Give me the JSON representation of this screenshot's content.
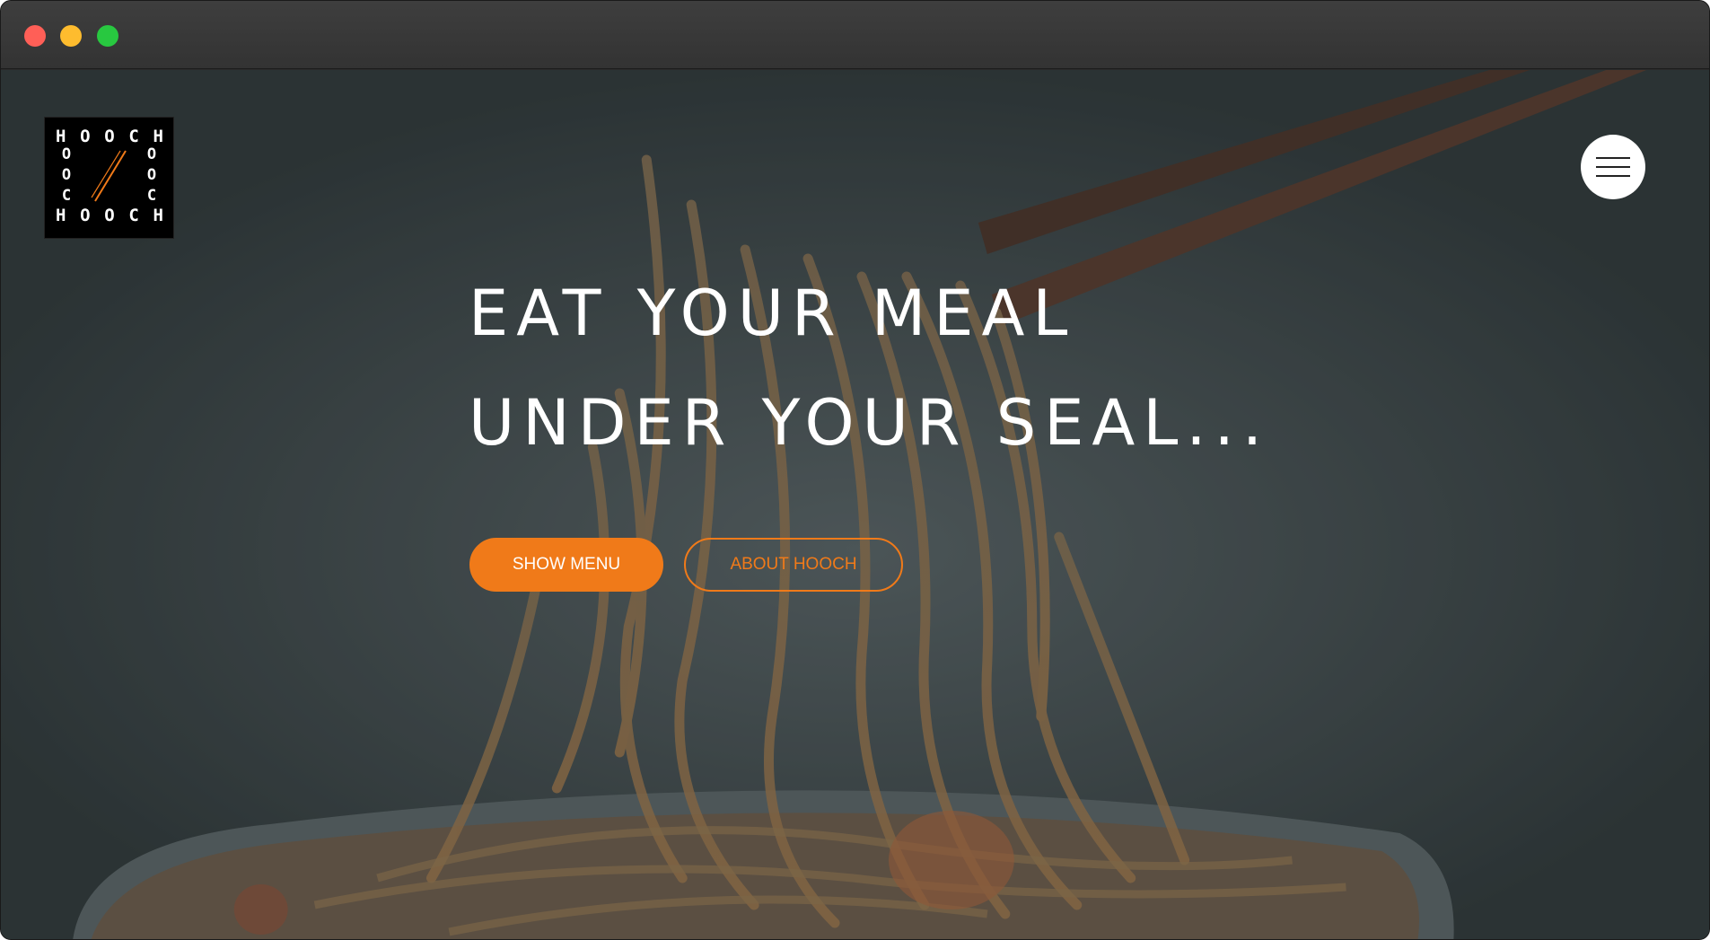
{
  "window": {
    "controls": [
      "close",
      "minimize",
      "zoom"
    ]
  },
  "logo": {
    "top_row": [
      "H",
      "O",
      "O",
      "C",
      "H"
    ],
    "bottom_row": [
      "H",
      "O",
      "O",
      "C",
      "H"
    ],
    "left_column": [
      "O",
      "O",
      "C"
    ],
    "right_column": [
      "O",
      "O",
      "C"
    ],
    "mark_color": "#f07a19"
  },
  "nav": {
    "menu_icon": "hamburger-icon"
  },
  "hero": {
    "line1": "EAT YOUR MEAL",
    "line2": "UNDER YOUR SEAL...",
    "primary_button": "SHOW MENU",
    "secondary_button": "ABOUT HOOCH"
  },
  "colors": {
    "accent": "#f07a19",
    "headline": "#ffffff",
    "background_tint": "#3e4749"
  }
}
